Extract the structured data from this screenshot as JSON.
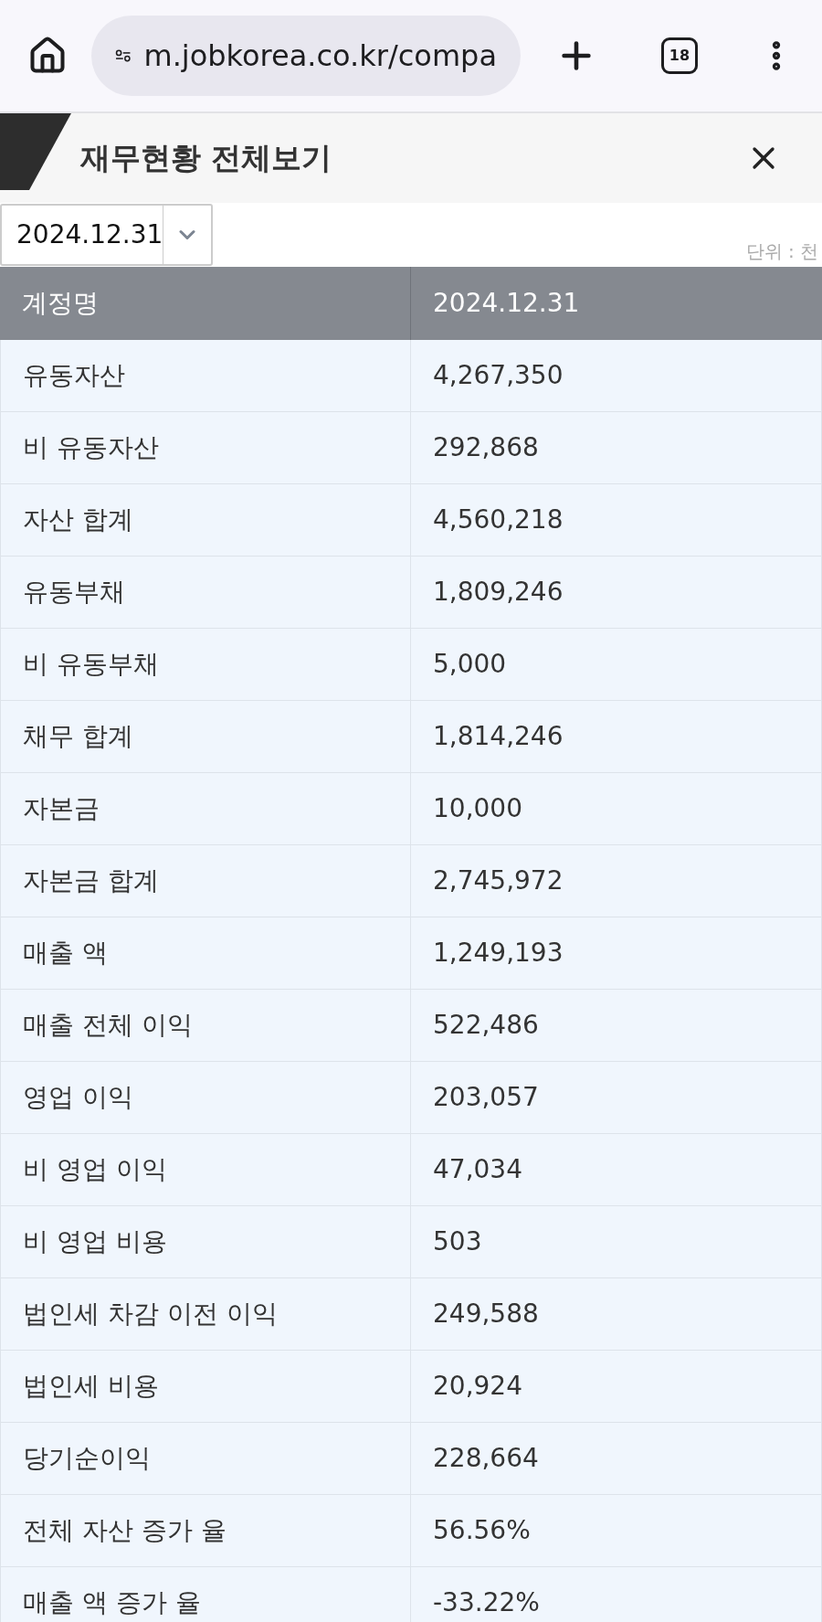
{
  "browser": {
    "url": "m.jobkorea.co.kr/compa",
    "tab_count": "18"
  },
  "header": {
    "title": "재무현황 전체보기"
  },
  "period_select": {
    "value": "2024.12.31"
  },
  "unit": "단위 : 천",
  "table": {
    "columns": [
      "계정명",
      "2024.12.31"
    ],
    "rows": [
      [
        "유동자산",
        "4,267,350"
      ],
      [
        "비 유동자산",
        "292,868"
      ],
      [
        "자산 합계",
        "4,560,218"
      ],
      [
        "유동부채",
        "1,809,246"
      ],
      [
        "비 유동부채",
        "5,000"
      ],
      [
        "채무 합계",
        "1,814,246"
      ],
      [
        "자본금",
        "10,000"
      ],
      [
        "자본금 합계",
        "2,745,972"
      ],
      [
        "매출 액",
        "1,249,193"
      ],
      [
        "매출 전체 이익",
        "522,486"
      ],
      [
        "영업 이익",
        "203,057"
      ],
      [
        "비 영업 이익",
        "47,034"
      ],
      [
        "비 영업 비용",
        "503"
      ],
      [
        "법인세 차감 이전 이익",
        "249,588"
      ],
      [
        "법인세 비용",
        "20,924"
      ],
      [
        "당기순이익",
        "228,664"
      ],
      [
        "전체 자산 증가 율",
        "56.56%"
      ],
      [
        "매출 액 증가 율",
        "-33.22%"
      ]
    ]
  }
}
